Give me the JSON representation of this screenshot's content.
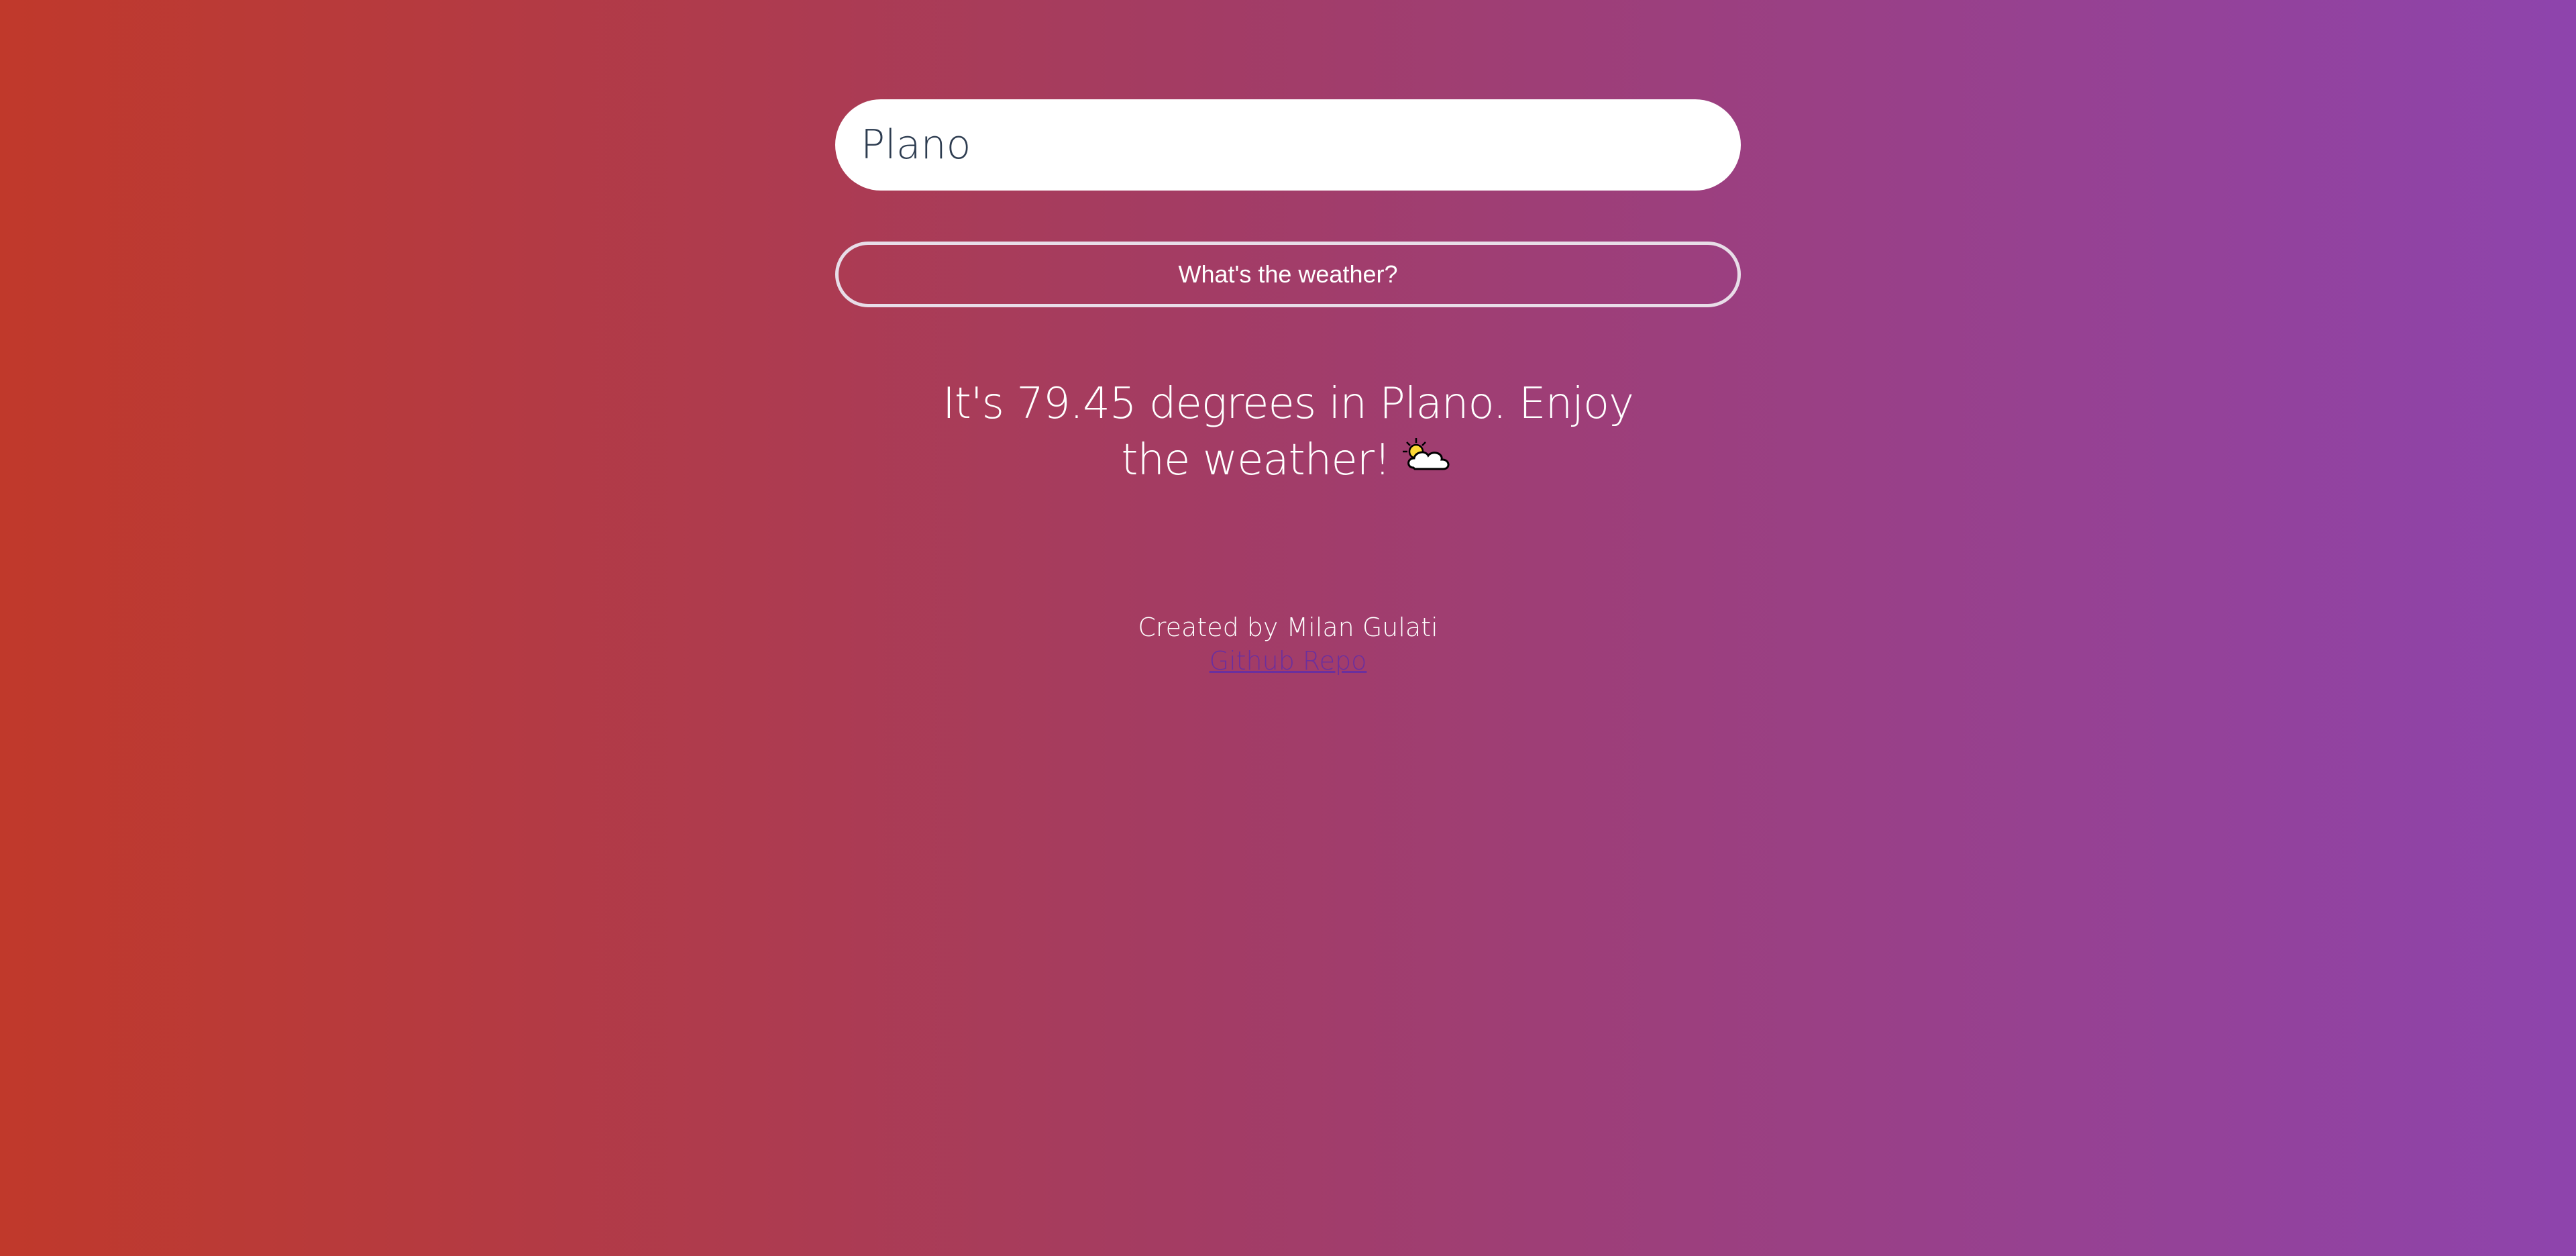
{
  "search": {
    "value": "Plano"
  },
  "submit": {
    "label": "What's the weather?"
  },
  "result": {
    "text": "It's 79.45 degrees in Plano. Enjoy the weather!",
    "icon": "sun-behind-cloud-icon"
  },
  "footer": {
    "credit": "Created by Milan Gulati",
    "link_text": "Github Repo"
  },
  "colors": {
    "gradient_start": "#c0392b",
    "gradient_end": "#8e44ad",
    "link": "#6b2f9e"
  }
}
